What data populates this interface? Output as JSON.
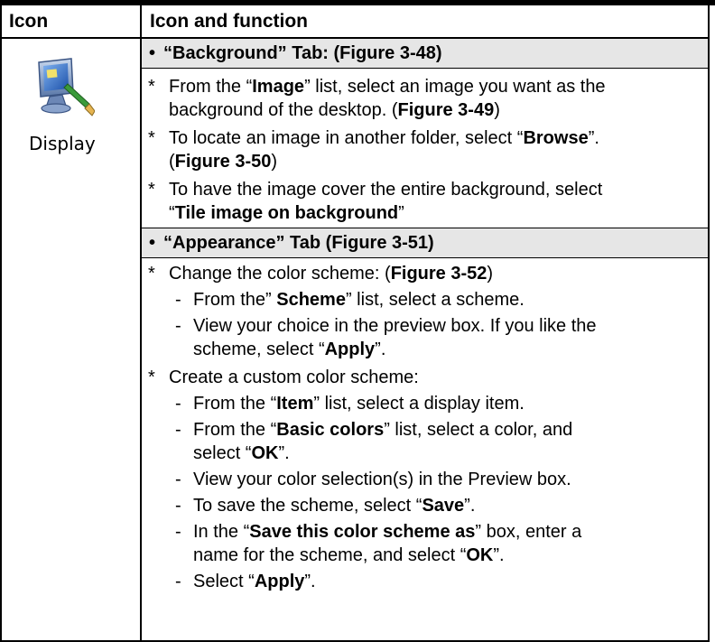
{
  "table": {
    "header_icon": "Icon",
    "header_function": "Icon and function"
  },
  "icon_cell": {
    "icon_name": "display-monitor-icon",
    "label": "Display"
  },
  "background_section": {
    "bullet": "•",
    "title": "“Background” Tab: (Figure 3-48)",
    "items": [
      {
        "l1_a": "From the “",
        "l1_b": "Image",
        "l1_c": "” list, select an image you want as the",
        "l2_a": "background of the desktop. (",
        "l2_b": "Figure 3-49",
        "l2_c": ")"
      },
      {
        "l1_a": "To locate an image in another folder, select “",
        "l1_b": "Browse",
        "l1_c": "”.",
        "l2_a": "(",
        "l2_b": "Figure 3-50",
        "l2_c": ")"
      },
      {
        "l1_a": "To have the image cover the entire background, select",
        "l2_a": "“",
        "l2_b": "Tile image on background",
        "l2_c": "”"
      }
    ]
  },
  "appearance_section": {
    "bullet": "•",
    "title": "“Appearance” Tab (Figure 3-51)",
    "change_scheme": {
      "a": "Change the color scheme: (",
      "b": "Figure 3-52",
      "c": ")",
      "sub": [
        {
          "a": "From the” ",
          "b": "Scheme",
          "c": "” list, select a scheme."
        },
        {
          "a": "View your choice in the preview box. If you like the",
          "a2": "scheme, select “",
          "b2": "Apply",
          "c2": "”."
        }
      ]
    },
    "custom_scheme": {
      "a": "Create a custom color scheme:",
      "sub": [
        {
          "a": "From the “",
          "b": "Item",
          "c": "” list, select a display item."
        },
        {
          "a": "From the “",
          "b": "Basic colors",
          "c": "” list, select a color, and",
          "a2": "select “",
          "b2": "OK",
          "c2": "”."
        },
        {
          "a": "View your color selection(s) in the Preview box."
        },
        {
          "a": "To save the scheme, select “",
          "b": "Save",
          "c": "”."
        },
        {
          "a": "In the “",
          "b": "Save this color scheme as",
          "c": "” box, enter a",
          "a2": "name for the scheme, and select “",
          "b2": "OK",
          "c2": "”."
        },
        {
          "a": "Select “",
          "b": "Apply",
          "c": "”."
        }
      ]
    },
    "star": "*",
    "dash": "-"
  }
}
